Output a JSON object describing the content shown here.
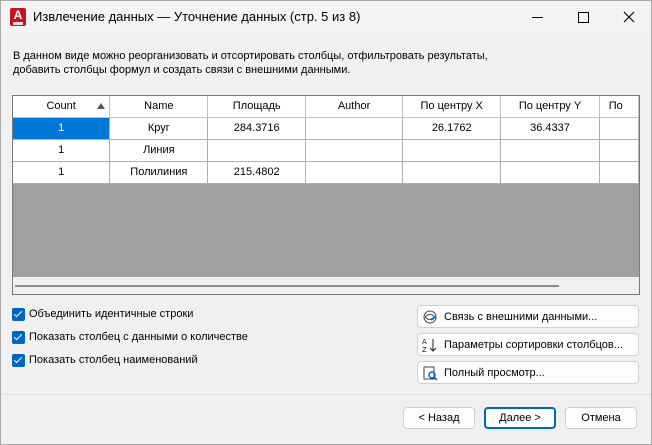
{
  "window": {
    "title": "Извлечение данных — Уточнение данных (стр. 5 из 8)",
    "app_icon_letter": "A"
  },
  "description": {
    "line1": "В данном виде можно реорганизовать и отсортировать столбцы, отфильтровать результаты,",
    "line2": "добавить столбцы формул и создать связи с внешними данными."
  },
  "grid": {
    "columns": [
      "Count",
      "Name",
      "Площадь",
      "Author",
      "По центру X",
      "По центру Y",
      "По"
    ],
    "rows": [
      [
        "1",
        "Круг",
        "284.3716",
        "",
        "26.1762",
        "36.4337",
        ""
      ],
      [
        "1",
        "Линия",
        "",
        "",
        "",
        "",
        ""
      ],
      [
        "1",
        "Полилиния",
        "215.4802",
        "",
        "",
        "",
        ""
      ]
    ],
    "sorted_column": "Count",
    "selected_cell": "row 1, Count"
  },
  "options": {
    "combine_identical": "Объединить идентичные строки",
    "show_count_column": "Показать столбец с данными о количестве",
    "show_name_column": "Показать столбец наименований"
  },
  "side_buttons": {
    "link_external": "Связь с внешними данными...",
    "sort_params": "Параметры сортировки столбцов...",
    "full_preview": "Полный просмотр..."
  },
  "footer": {
    "back": "< Назад",
    "next": "Далее >",
    "cancel": "Отмена"
  },
  "colors": {
    "accent": "#0067c0",
    "selection": "#0078d7",
    "app_icon": "#c4161c"
  }
}
